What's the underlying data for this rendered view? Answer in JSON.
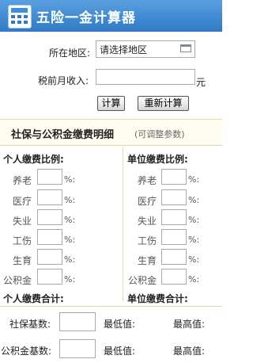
{
  "header": {
    "title": "五险一金计算器",
    "logo_icon": "calculator-logo-icon"
  },
  "form": {
    "region_label": "所在地区:",
    "region_value": "请选择地区",
    "income_label": "税前月收入:",
    "income_value": "",
    "income_unit": "元",
    "calc_button": "计算",
    "recalc_button": "重新计算"
  },
  "detail": {
    "title": "社保与公积金缴费明细",
    "note": "(可调整参数)",
    "personal": {
      "title": "个人缴费比例:",
      "rows": [
        "养老",
        "医疗",
        "失业",
        "工伤",
        "生育",
        "公积金"
      ],
      "total_label": "个人缴费合计:"
    },
    "employer": {
      "title": "单位缴费比例:",
      "rows": [
        "养老",
        "医疗",
        "失业",
        "工伤",
        "生育",
        "公积金"
      ],
      "total_label": "单位缴费合计:"
    },
    "percent_suffix": "%:"
  },
  "bases": {
    "social_label": "社保基数:",
    "fund_label": "公积金基数:",
    "min_label": "最低值:",
    "max_label": "最高值:"
  }
}
